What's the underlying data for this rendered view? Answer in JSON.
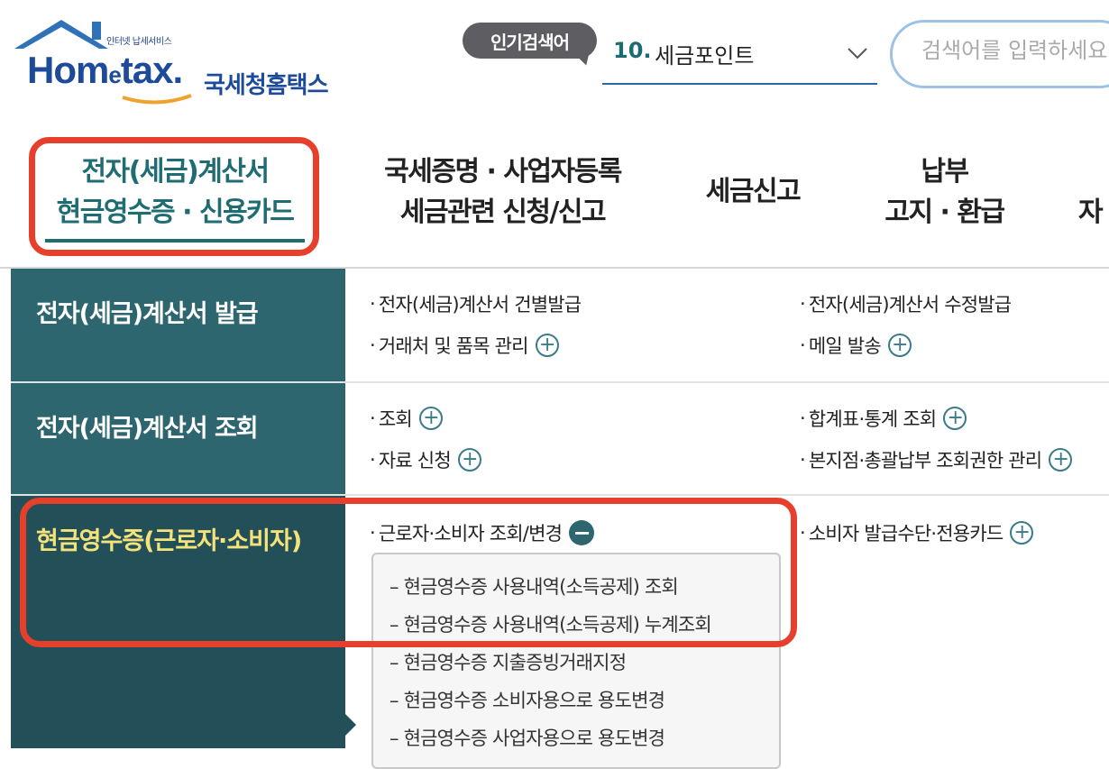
{
  "header": {
    "logo_tag": "인터넷 납세서비스",
    "logo_text_a": "Hom",
    "logo_text_e": "e",
    "logo_text_b": "tax.",
    "logo_kr": "국세청홈택스",
    "popular_label": "인기검색어",
    "popular_number": "10.",
    "popular_keyword": "세금포인트",
    "search_placeholder": "검색어를 입력하세요"
  },
  "nav": [
    {
      "line1": "전자(세금)계산서",
      "line2": "현금영수증 · 신용카드"
    },
    {
      "line1": "국세증명 · 사업자등록",
      "line2": "세금관련 신청/신고"
    },
    {
      "line1": "세금신고"
    },
    {
      "line1": "납부",
      "line2": "고지 · 환급"
    },
    {
      "line1": "자"
    }
  ],
  "side_menu": [
    {
      "label": "전자(세금)계산서 발급"
    },
    {
      "label": "전자(세금)계산서 조회"
    },
    {
      "label": "현금영수증(근로자·소비자)"
    }
  ],
  "links": {
    "issue_single": "전자(세금)계산서 건별발급",
    "issue_modify": "전자(세금)계산서 수정발급",
    "partners_items": "거래처 및 품목 관리",
    "mail_send": "메일 발송",
    "lookup": "조회",
    "summary_stats": "합계표·통계 조회",
    "data_request": "자료 신청",
    "branch_authority": "본지점·총괄납부 조회권한 관리",
    "worker_consumer": "근로자·소비자 조회/변경",
    "consumer_card": "소비자 발급수단·전용카드"
  },
  "submenu": [
    "– 현금영수증 사용내역(소득공제) 조회",
    "– 현금영수증 사용내역(소득공제) 누계조회",
    "– 현금영수증 지출증빙거래지정",
    "– 현금영수증 소비자용으로 용도변경",
    "– 현금영수증 사업자용으로 용도변경"
  ],
  "colors": {
    "brand": "#1d4b9a",
    "teal": "#2e6670",
    "highlight": "#e6402c",
    "active_text": "#f4e27a"
  }
}
